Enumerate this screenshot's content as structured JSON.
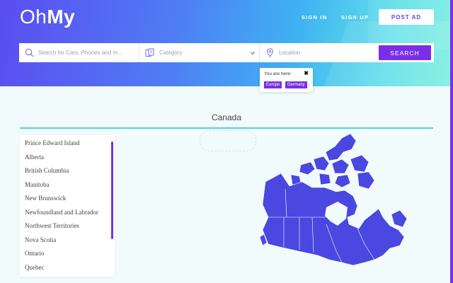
{
  "brand": {
    "logo_part1": "Oh",
    "logo_part2": "My"
  },
  "nav": {
    "signin": "SIGN IN",
    "signup": "SIGN UP",
    "post_ad": "POST AD"
  },
  "search": {
    "query_placeholder": "Search for Cars, Phones and m...",
    "category_label": "Category",
    "location_placeholder": "Location",
    "button": "SEARCH"
  },
  "location_popup": {
    "title": "You are here:",
    "close": "✖",
    "breadcrumbs": [
      "Europe",
      "Germany"
    ]
  },
  "region": {
    "title": "Canada",
    "provinces": [
      "Prince Edward Island",
      "Alberta",
      "British Columbia",
      "Manitoba",
      "New Brunswick",
      "Newfoundland and Labrador",
      "Northwest Territories",
      "Nova Scotia",
      "Ontario",
      "Quebec"
    ]
  },
  "colors": {
    "accent": "#7a2fe6",
    "map_fill": "#4a48e0",
    "divider": "#4fd0dc"
  },
  "icons": {
    "search": "search-icon",
    "category": "category-icon",
    "location": "location-pin-icon",
    "chevron": "chevron-down-icon",
    "close": "close-icon"
  }
}
